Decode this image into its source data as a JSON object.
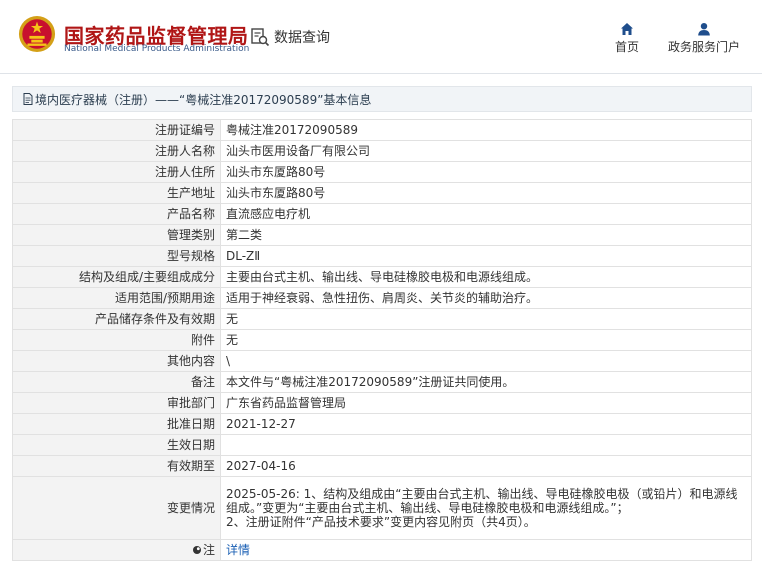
{
  "header": {
    "org_name_cn": "国家药品监督管理局",
    "org_name_en": "National Medical Products Administration",
    "data_query_label": "数据查询",
    "nav": [
      {
        "label": "首页",
        "icon": "home-icon"
      },
      {
        "label": "政务服务门户",
        "icon": "user-icon"
      }
    ]
  },
  "breadcrumb": {
    "text": "境内医疗器械（注册）——“粤械注准20172090589”基本信息"
  },
  "details": [
    {
      "label": "注册证编号",
      "value": "粤械注准20172090589"
    },
    {
      "label": "注册人名称",
      "value": "汕头市医用设备厂有限公司"
    },
    {
      "label": "注册人住所",
      "value": "汕头市东厦路80号"
    },
    {
      "label": "生产地址",
      "value": "汕头市东厦路80号"
    },
    {
      "label": "产品名称",
      "value": "直流感应电疗机"
    },
    {
      "label": "管理类别",
      "value": "第二类"
    },
    {
      "label": "型号规格",
      "value": "DL-ZⅡ"
    },
    {
      "label": "结构及组成/主要组成成分",
      "value": "主要由台式主机、输出线、导电硅橡胶电极和电源线组成。"
    },
    {
      "label": "适用范围/预期用途",
      "value": "适用于神经衰弱、急性扭伤、肩周炎、关节炎的辅助治疗。"
    },
    {
      "label": "产品储存条件及有效期",
      "value": "无"
    },
    {
      "label": "附件",
      "value": "无"
    },
    {
      "label": "其他内容",
      "value": "\\"
    },
    {
      "label": "备注",
      "value": "本文件与“粤械注准20172090589”注册证共同使用。"
    },
    {
      "label": "审批部门",
      "value": "广东省药品监督管理局"
    },
    {
      "label": "批准日期",
      "value": "2021-12-27"
    },
    {
      "label": "生效日期",
      "value": ""
    },
    {
      "label": "有效期至",
      "value": "2027-04-16"
    }
  ],
  "change": {
    "label": "变更情况",
    "line1": "2025-05-26: 1、结构及组成由“主要由台式主机、输出线、导电硅橡胶电极（或铅片）和电源线组成。”变更为“主要由台式主机、输出线、导电硅橡胶电极和电源线组成。”；",
    "line2": "2、注册证附件“产品技术要求”变更内容见附页（共4页）。"
  },
  "note": {
    "label": "注",
    "link_text": "详情"
  }
}
